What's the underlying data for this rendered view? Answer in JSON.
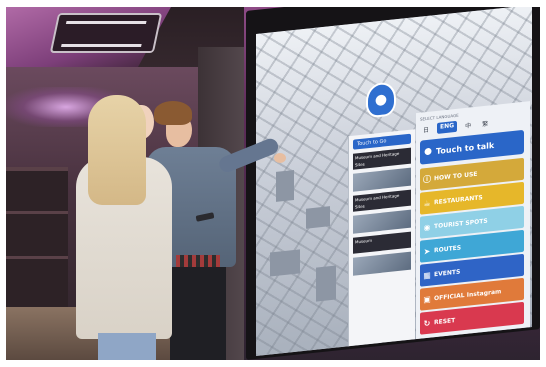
{
  "screen": {
    "panel_header": "Touch to Go",
    "cards": [
      "Museum and Heritage Sites",
      "Museum and Heritage Sites",
      "Museum"
    ],
    "language_label": "SELECT LANGUAGE",
    "languages": [
      "日",
      "ENG",
      "中",
      "繁"
    ],
    "active_language": "ENG",
    "talk_button": "Touch to talk",
    "menu": [
      {
        "label": "HOW TO USE",
        "icon": "info-icon",
        "color": "#d4a93a"
      },
      {
        "label": "RESTAURANTS",
        "icon": "restaurant-icon",
        "color": "#e6b72a"
      },
      {
        "label": "TOURIST SPOTS",
        "icon": "camera-icon",
        "color": "#8fd0e6"
      },
      {
        "label": "ROUTES",
        "icon": "route-icon",
        "color": "#3fa7d6"
      },
      {
        "label": "EVENTS",
        "icon": "calendar-icon",
        "color": "#2f64c6"
      },
      {
        "label": "OFFICIAL Instagram",
        "icon": "instagram-icon",
        "color": "#e07a3a"
      },
      {
        "label": "RESET",
        "icon": "reset-icon",
        "color": "#d9394f"
      }
    ]
  }
}
